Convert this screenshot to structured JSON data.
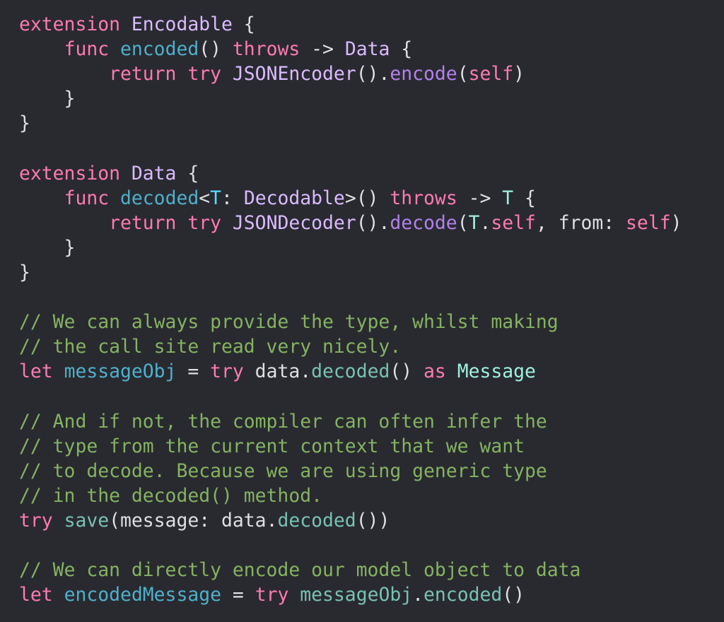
{
  "editor": {
    "theme": {
      "background": "#292a30",
      "plain": "#dfdfe0",
      "keyword": "#ff7ab2",
      "declaration": "#4eb0cc",
      "system_type": "#dabaff",
      "system_function": "#b281eb",
      "project_symbol": "#78c2b3",
      "project_type": "#9ef1dd",
      "type_declaration": "#5dd8ff",
      "comment": "#84b360"
    },
    "lines": [
      [
        [
          "keyword",
          "extension"
        ],
        [
          "plain",
          " "
        ],
        [
          "type",
          "Encodable"
        ],
        [
          "plain",
          " {"
        ]
      ],
      [
        [
          "plain",
          "    "
        ],
        [
          "keyword",
          "func"
        ],
        [
          "plain",
          " "
        ],
        [
          "decl",
          "encoded"
        ],
        [
          "plain",
          "() "
        ],
        [
          "keyword",
          "throws"
        ],
        [
          "plain",
          " -> "
        ],
        [
          "type",
          "Data"
        ],
        [
          "plain",
          " {"
        ]
      ],
      [
        [
          "plain",
          "        "
        ],
        [
          "keyword",
          "return"
        ],
        [
          "plain",
          " "
        ],
        [
          "keyword",
          "try"
        ],
        [
          "plain",
          " "
        ],
        [
          "type",
          "JSONEncoder"
        ],
        [
          "plain",
          "()."
        ],
        [
          "sysfn",
          "encode"
        ],
        [
          "plain",
          "("
        ],
        [
          "keyword",
          "self"
        ],
        [
          "plain",
          ")"
        ]
      ],
      [
        [
          "plain",
          "    }"
        ]
      ],
      [
        [
          "plain",
          "}"
        ]
      ],
      [],
      [
        [
          "keyword",
          "extension"
        ],
        [
          "plain",
          " "
        ],
        [
          "type",
          "Data"
        ],
        [
          "plain",
          " {"
        ]
      ],
      [
        [
          "plain",
          "    "
        ],
        [
          "keyword",
          "func"
        ],
        [
          "plain",
          " "
        ],
        [
          "decl",
          "decoded"
        ],
        [
          "plain",
          "<"
        ],
        [
          "typedecl",
          "T"
        ],
        [
          "plain",
          ": "
        ],
        [
          "type",
          "Decodable"
        ],
        [
          "plain",
          ">() "
        ],
        [
          "keyword",
          "throws"
        ],
        [
          "plain",
          " -> "
        ],
        [
          "projtype",
          "T"
        ],
        [
          "plain",
          " {"
        ]
      ],
      [
        [
          "plain",
          "        "
        ],
        [
          "keyword",
          "return"
        ],
        [
          "plain",
          " "
        ],
        [
          "keyword",
          "try"
        ],
        [
          "plain",
          " "
        ],
        [
          "type",
          "JSONDecoder"
        ],
        [
          "plain",
          "()."
        ],
        [
          "sysfn",
          "decode"
        ],
        [
          "plain",
          "("
        ],
        [
          "projtype",
          "T"
        ],
        [
          "plain",
          "."
        ],
        [
          "keyword",
          "self"
        ],
        [
          "plain",
          ", from: "
        ],
        [
          "keyword",
          "self"
        ],
        [
          "plain",
          ")"
        ]
      ],
      [
        [
          "plain",
          "    }"
        ]
      ],
      [
        [
          "plain",
          "}"
        ]
      ],
      [],
      [
        [
          "comment",
          "// We can always provide the type, whilst making"
        ]
      ],
      [
        [
          "comment",
          "// the call site read very nicely."
        ]
      ],
      [
        [
          "keyword",
          "let"
        ],
        [
          "plain",
          " "
        ],
        [
          "decl",
          "messageObj"
        ],
        [
          "plain",
          " = "
        ],
        [
          "keyword",
          "try"
        ],
        [
          "plain",
          " data."
        ],
        [
          "proj",
          "decoded"
        ],
        [
          "plain",
          "() "
        ],
        [
          "keyword",
          "as"
        ],
        [
          "plain",
          " "
        ],
        [
          "projtype",
          "Message"
        ]
      ],
      [],
      [
        [
          "comment",
          "// And if not, the compiler can often infer the"
        ]
      ],
      [
        [
          "comment",
          "// type from the current context that we want"
        ]
      ],
      [
        [
          "comment",
          "// to decode. Because we are using generic type"
        ]
      ],
      [
        [
          "comment",
          "// in the decoded() method."
        ]
      ],
      [
        [
          "keyword",
          "try"
        ],
        [
          "plain",
          " "
        ],
        [
          "proj",
          "save"
        ],
        [
          "plain",
          "(message: data."
        ],
        [
          "proj",
          "decoded"
        ],
        [
          "plain",
          "())"
        ]
      ],
      [],
      [
        [
          "comment",
          "// We can directly encode our model object to data"
        ]
      ],
      [
        [
          "keyword",
          "let"
        ],
        [
          "plain",
          " "
        ],
        [
          "decl",
          "encodedMessage"
        ],
        [
          "plain",
          " = "
        ],
        [
          "keyword",
          "try"
        ],
        [
          "plain",
          " "
        ],
        [
          "proj",
          "messageObj"
        ],
        [
          "plain",
          "."
        ],
        [
          "proj",
          "encoded"
        ],
        [
          "plain",
          "()"
        ]
      ]
    ]
  }
}
